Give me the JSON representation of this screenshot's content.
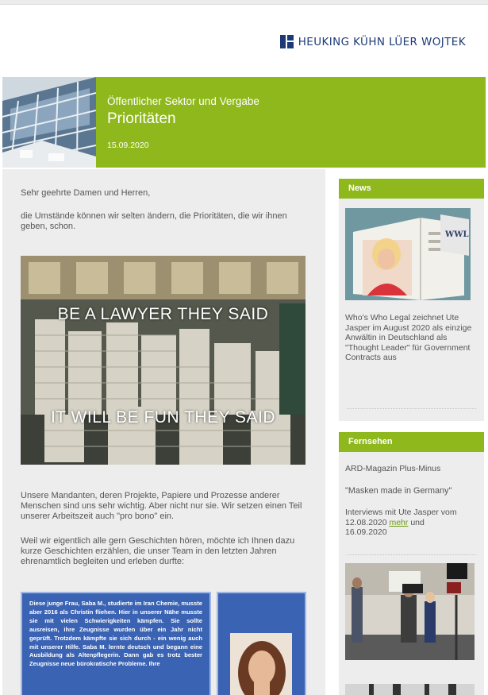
{
  "brand": {
    "name": "HEUKING KÜHN LÜER WOJTEK",
    "color": "#1d3a78"
  },
  "colors": {
    "accent_green": "#8fb81c",
    "box_blue": "#3b63b4",
    "link_green": "#6f9a12",
    "panel_grey": "#ededed"
  },
  "banner": {
    "section": "Öffentlicher Sektor und Vergabe",
    "title": "Prioritäten",
    "date": "15.09.2020",
    "image_icon": "glass-building-photo"
  },
  "main": {
    "greeting": "Sehr geehrte Damen und Herren,",
    "intro": "die Umstände können wir selten ändern, die Prioritäten, die wir ihnen geben, schon.",
    "meme": {
      "top_text": "BE A LAWYER THEY SAID",
      "bottom_text": "IT WILL BE FUN THEY SAID",
      "image_icon": "paper-stacks-photo"
    },
    "paragraph1": "Unsere Mandanten, deren Projekte, Papiere und Prozesse anderer Menschen sind uns sehr wichtig. Aber nicht nur sie. Wir setzen einen Teil unserer Arbeitszeit auch \"pro bono\" ein.",
    "paragraph2": "Weil wir eigentlich alle gern Geschichten hören, möchte ich Ihnen dazu kurze Geschichten erzählen, die unser Team in den letzten Jahren ehrenamtlich begleiten und erleben durfte:",
    "story": "Diese junge Frau, Saba M., studierte im Iran Chemie, musste aber 2016 als Christin fliehen. Hier in unserer Nähe musste sie mit vielen Schwierigkeiten kämpfen. Sie sollte ausreisen, ihre Zeugnisse wurden über ein Jahr nicht geprüft. Trotzdem kämpfte sie sich durch - ein wenig auch mit unserer Hilfe. Saba M. lernte deutsch und begann eine Ausbildung als Altenpflegerin. Dann gab es trotz bester Zeugnisse neue bürokratische Probleme. Ihre",
    "portrait_icon": "woman-portrait-photo"
  },
  "sidebar": {
    "news": {
      "heading": "News",
      "image_icon": "magazine-photo",
      "text": "Who's Who Legal zeichnet Ute Jasper im August 2020 als einzige Anwältin in Deutschland als \"Thought Leader\" für Government Contracts aus"
    },
    "tv": {
      "heading": "Fernsehen",
      "program": "ARD-Magazin Plus-Minus",
      "title": "\"Masken made in Germany\"",
      "text_before": "Interviews mit Ute Jasper vom 12.08.2020 ",
      "link": "mehr",
      "text_after": " und 16.09.2020",
      "image_icon": "tv-interview-photo"
    }
  }
}
